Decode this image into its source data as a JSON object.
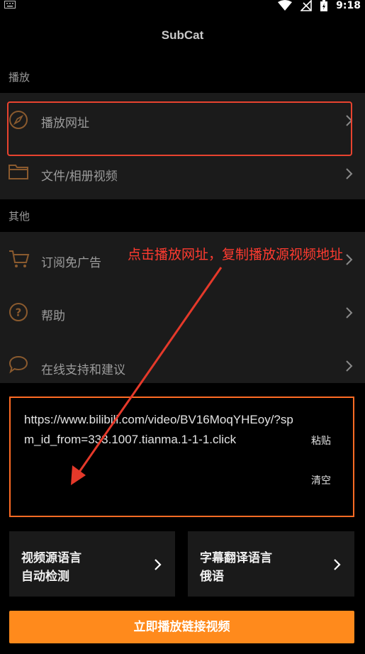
{
  "status_bar": {
    "time": "9:18"
  },
  "app": {
    "title": "SubCat"
  },
  "sections": {
    "play": {
      "label": "播放"
    },
    "other": {
      "label": "其他"
    }
  },
  "items": {
    "play_url": "播放网址",
    "files": "文件/相册视频",
    "subscribe": "订阅免广告",
    "help": "帮助",
    "support": "在线支持和建议"
  },
  "annotation": {
    "text": "点击播放网址，复制播放源视频地址"
  },
  "url_input": {
    "value": "https://www.bilibili.com/video/BV16MoqYHEoy/?spm_id_from=333.1007.tianma.1-1-1.click",
    "paste_label": "粘贴",
    "clear_label": "清空"
  },
  "source_lang": {
    "title": "视频源语言",
    "value": "自动检测"
  },
  "target_lang": {
    "title": "字幕翻译语言",
    "value": "俄语"
  },
  "cta": {
    "label": "立即播放链接视频"
  },
  "colors": {
    "accent": "#ff8a1c",
    "annotation": "#ff3b30",
    "icon": "#8a5a2e"
  }
}
